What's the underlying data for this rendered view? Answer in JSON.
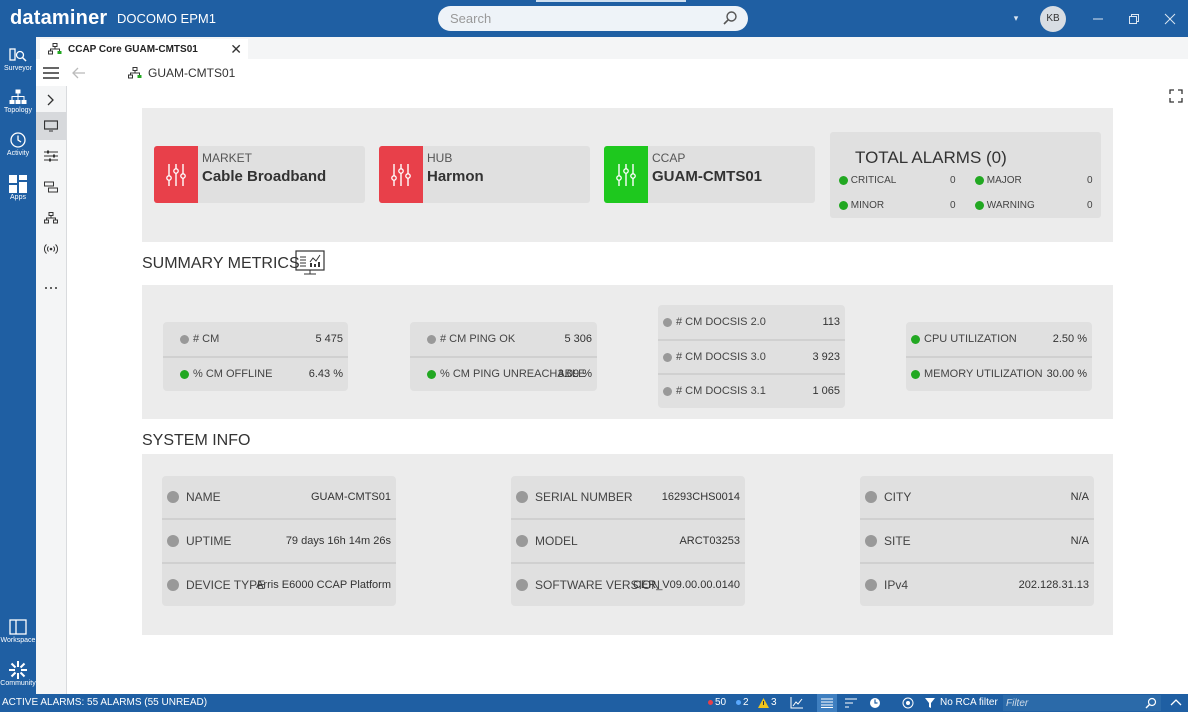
{
  "app": {
    "logo": "dataminer",
    "name": "DOCOMO EPM1",
    "avatar_initials": "KB",
    "brand_color": "#1f5fa3"
  },
  "search": {
    "placeholder": "Search"
  },
  "left_nav": [
    {
      "label": "Surveyor",
      "icon": "surveyor-icon"
    },
    {
      "label": "Topology",
      "icon": "topology-icon"
    },
    {
      "label": "Activity",
      "icon": "activity-icon"
    },
    {
      "label": "Apps",
      "icon": "apps-icon"
    },
    {
      "label": "Workspace",
      "icon": "workspace-icon"
    },
    {
      "label": "Community",
      "icon": "community-icon"
    }
  ],
  "tab": {
    "label": "CCAP Core GUAM-CMTS01"
  },
  "breadcrumb": {
    "label": "GUAM-CMTS01"
  },
  "categories": [
    {
      "label": "MARKET",
      "value": "Cable Broadband",
      "color": "#e8404a"
    },
    {
      "label": "HUB",
      "value": "Harmon",
      "color": "#e8404a"
    },
    {
      "label": "CCAP",
      "value": "GUAM-CMTS01",
      "color": "#1ec81e"
    }
  ],
  "alarms": {
    "title": "TOTAL ALARMS (0)",
    "critical_label": "CRITICAL",
    "critical_value": "0",
    "major_label": "MAJOR",
    "major_value": "0",
    "minor_label": "MINOR",
    "minor_value": "0",
    "warning_label": "WARNING",
    "warning_value": "0"
  },
  "summary": {
    "title": "SUMMARY METRICS",
    "cm": {
      "label": "# CM",
      "value": "5 475"
    },
    "cm_offline": {
      "label": "% CM OFFLINE",
      "value": "6.43 %"
    },
    "cm_ping_ok": {
      "label": "# CM PING OK",
      "value": "5 306"
    },
    "cm_ping_unreachable": {
      "label": "% CM PING UNREACHABLE",
      "value": "3.09 %"
    },
    "docsis20": {
      "label": "# CM DOCSIS 2.0",
      "value": "113"
    },
    "docsis30": {
      "label": "# CM DOCSIS 3.0",
      "value": "3 923"
    },
    "docsis31": {
      "label": "# CM DOCSIS 3.1",
      "value": "1 065"
    },
    "cpu": {
      "label": "CPU UTILIZATION",
      "value": "2.50 %"
    },
    "memory": {
      "label": "MEMORY UTILIZATION",
      "value": "30.00 %"
    }
  },
  "system": {
    "title": "SYSTEM INFO",
    "name": {
      "label": "NAME",
      "value": "GUAM-CMTS01"
    },
    "uptime": {
      "label": "UPTIME",
      "value": "79 days 16h 14m 26s"
    },
    "device_type": {
      "label": "DEVICE TYPE",
      "value": "Arris E6000 CCAP Platform"
    },
    "serial": {
      "label": "SERIAL NUMBER",
      "value": "16293CHS0014"
    },
    "model": {
      "label": "MODEL",
      "value": "ARCT03253"
    },
    "software": {
      "label": "SOFTWARE VERSION",
      "value": "CER_V09.00.00.0140"
    },
    "city": {
      "label": "CITY",
      "value": "N/A"
    },
    "site": {
      "label": "SITE",
      "value": "N/A"
    },
    "ipv4": {
      "label": "IPv4",
      "value": "202.128.31.13"
    }
  },
  "statusbar": {
    "active_alarms": "ACTIVE ALARMS: 55 ALARMS (55 UNREAD)",
    "count_red": "50",
    "count_blue": "2",
    "count_warning": "3",
    "rca_filter": "No RCA filter",
    "filter_placeholder": "Filter"
  }
}
